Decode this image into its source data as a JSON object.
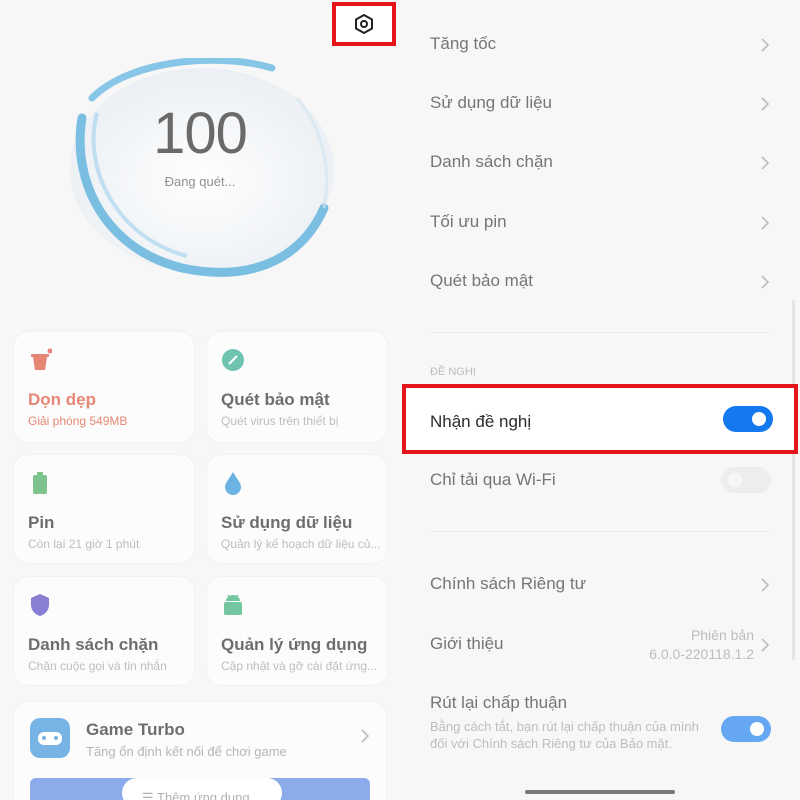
{
  "left": {
    "score": "100",
    "scan_status": "Đang quét...",
    "cards": [
      {
        "title": "Dọn dẹp",
        "sub": "Giải phóng 549MB",
        "color": "#d9452b"
      },
      {
        "title": "Quét bảo mật",
        "sub": "Quét virus trên thiết bị"
      },
      {
        "title": "Pin",
        "sub": "Còn lại 21 giờ 1 phút"
      },
      {
        "title": "Sử dụng dữ liệu",
        "sub": "Quản lý kế hoạch dữ liệu củ..."
      },
      {
        "title": "Danh sách chặn",
        "sub": "Chặn cuộc gọi và tin nhắn"
      },
      {
        "title": "Quản lý ứng dụng",
        "sub": "Cập nhật và gỡ cài đặt ứng..."
      }
    ],
    "game_turbo": {
      "title": "Game Turbo",
      "sub": "Tăng ổn định kết nối để chơi game",
      "button": "☰  Thêm ứng dụng"
    }
  },
  "right": {
    "items_top": [
      "Tăng tốc",
      "Sử dụng dữ liệu",
      "Danh sách chặn",
      "Tối ưu pin",
      "Quét bảo mật"
    ],
    "section_label": "ĐỀ NGHỊ",
    "recommend": {
      "label": "Nhận đề nghị",
      "enabled": true
    },
    "wifi_only": {
      "label": "Chỉ tải qua Wi-Fi",
      "enabled": false
    },
    "privacy": "Chính sách Riêng tư",
    "about": {
      "label": "Giới thiệu",
      "version_line1": "Phiên bản",
      "version_line2": "6.0.0-220118.1.2"
    },
    "revoke": {
      "label": "Rút lại chấp thuận",
      "desc": "Bằng cách tắt, bạn rút lại chấp thuận của mình đối với Chính sách Riêng tư của Bảo mật.",
      "enabled": true
    }
  },
  "colors": {
    "accent": "#1479ef",
    "highlight_border": "#e4161c",
    "clean_red": "#d9452b"
  }
}
